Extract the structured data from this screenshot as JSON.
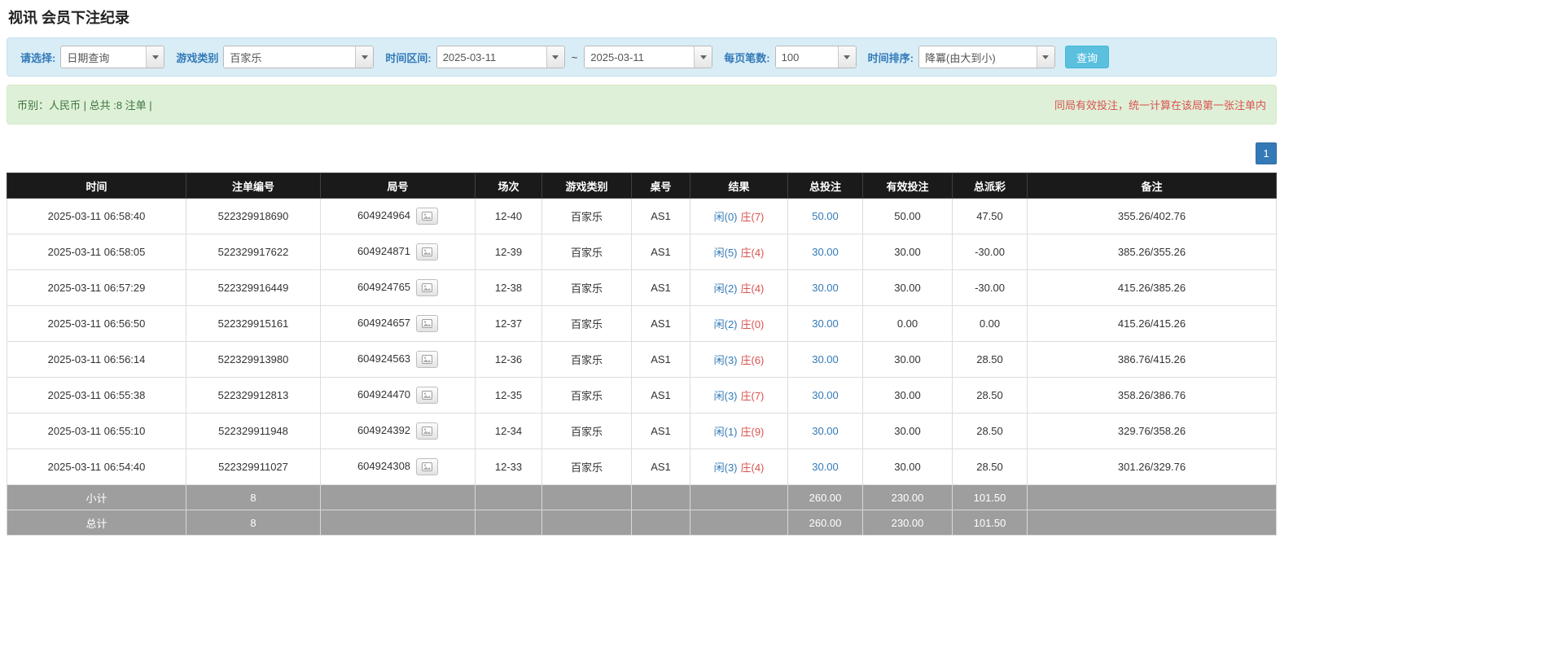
{
  "colors": {
    "accent_blue": "#337ab7",
    "filter_bar_bg": "#d9edf7",
    "status_bar_bg": "#dff0d8",
    "danger_red": "#d9534f",
    "table_header_bg": "#1a1a1a",
    "summary_row_bg": "#9e9e9e",
    "search_button_bg": "#5bc0de"
  },
  "page": {
    "title": "视讯 会员下注纪录"
  },
  "filters": {
    "select_label": "请选择:",
    "select_value": "日期查询",
    "game_type_label": "游戏类别",
    "game_type_value": "百家乐",
    "time_range_label": "时间区间:",
    "date_from": "2025-03-11",
    "range_separator": "~",
    "date_to": "2025-03-11",
    "page_size_label": "每页笔数:",
    "page_size_value": "100",
    "sort_label": "时间排序:",
    "sort_value": "降冪(由大到小)",
    "search_button_label": "查询"
  },
  "status_bar": {
    "summary": "币别：人民币 | 总共 :8 注单 |",
    "notice": "同局有效投注，统一计算在该局第一张注单内"
  },
  "pagination": {
    "current_page": "1"
  },
  "table": {
    "headers": [
      "时间",
      "注单编号",
      "局号",
      "场次",
      "游戏类别",
      "桌号",
      "结果",
      "总投注",
      "有效投注",
      "总派彩",
      "备注"
    ],
    "rows": [
      {
        "time": "2025-03-11 06:58:40",
        "bet_id": "522329918690",
        "round_id": "604924964",
        "session": "12-40",
        "game_type": "百家乐",
        "table_no": "AS1",
        "result_player": "闲(0)",
        "result_banker": "庄(7)",
        "total_bet": "50.00",
        "valid_bet": "50.00",
        "payout": "47.50",
        "note": "355.26/402.76"
      },
      {
        "time": "2025-03-11 06:58:05",
        "bet_id": "522329917622",
        "round_id": "604924871",
        "session": "12-39",
        "game_type": "百家乐",
        "table_no": "AS1",
        "result_player": "闲(5)",
        "result_banker": "庄(4)",
        "total_bet": "30.00",
        "valid_bet": "30.00",
        "payout": "-30.00",
        "note": "385.26/355.26"
      },
      {
        "time": "2025-03-11 06:57:29",
        "bet_id": "522329916449",
        "round_id": "604924765",
        "session": "12-38",
        "game_type": "百家乐",
        "table_no": "AS1",
        "result_player": "闲(2)",
        "result_banker": "庄(4)",
        "total_bet": "30.00",
        "valid_bet": "30.00",
        "payout": "-30.00",
        "note": "415.26/385.26"
      },
      {
        "time": "2025-03-11 06:56:50",
        "bet_id": "522329915161",
        "round_id": "604924657",
        "session": "12-37",
        "game_type": "百家乐",
        "table_no": "AS1",
        "result_player": "闲(2)",
        "result_banker": "庄(0)",
        "total_bet": "30.00",
        "valid_bet": "0.00",
        "payout": "0.00",
        "note": "415.26/415.26"
      },
      {
        "time": "2025-03-11 06:56:14",
        "bet_id": "522329913980",
        "round_id": "604924563",
        "session": "12-36",
        "game_type": "百家乐",
        "table_no": "AS1",
        "result_player": "闲(3)",
        "result_banker": "庄(6)",
        "total_bet": "30.00",
        "valid_bet": "30.00",
        "payout": "28.50",
        "note": "386.76/415.26"
      },
      {
        "time": "2025-03-11 06:55:38",
        "bet_id": "522329912813",
        "round_id": "604924470",
        "session": "12-35",
        "game_type": "百家乐",
        "table_no": "AS1",
        "result_player": "闲(3)",
        "result_banker": "庄(7)",
        "total_bet": "30.00",
        "valid_bet": "30.00",
        "payout": "28.50",
        "note": "358.26/386.76"
      },
      {
        "time": "2025-03-11 06:55:10",
        "bet_id": "522329911948",
        "round_id": "604924392",
        "session": "12-34",
        "game_type": "百家乐",
        "table_no": "AS1",
        "result_player": "闲(1)",
        "result_banker": "庄(9)",
        "total_bet": "30.00",
        "valid_bet": "30.00",
        "payout": "28.50",
        "note": "329.76/358.26"
      },
      {
        "time": "2025-03-11 06:54:40",
        "bet_id": "522329911027",
        "round_id": "604924308",
        "session": "12-33",
        "game_type": "百家乐",
        "table_no": "AS1",
        "result_player": "闲(3)",
        "result_banker": "庄(4)",
        "total_bet": "30.00",
        "valid_bet": "30.00",
        "payout": "28.50",
        "note": "301.26/329.76"
      }
    ],
    "subtotal_row": {
      "label": "小计",
      "count": "8",
      "total_bet": "260.00",
      "valid_bet": "230.00",
      "total_payout": "101.50"
    },
    "grand_total_row": {
      "label": "总计",
      "count": "8",
      "total_bet": "260.00",
      "valid_bet": "230.00",
      "total_payout": "101.50"
    }
  }
}
